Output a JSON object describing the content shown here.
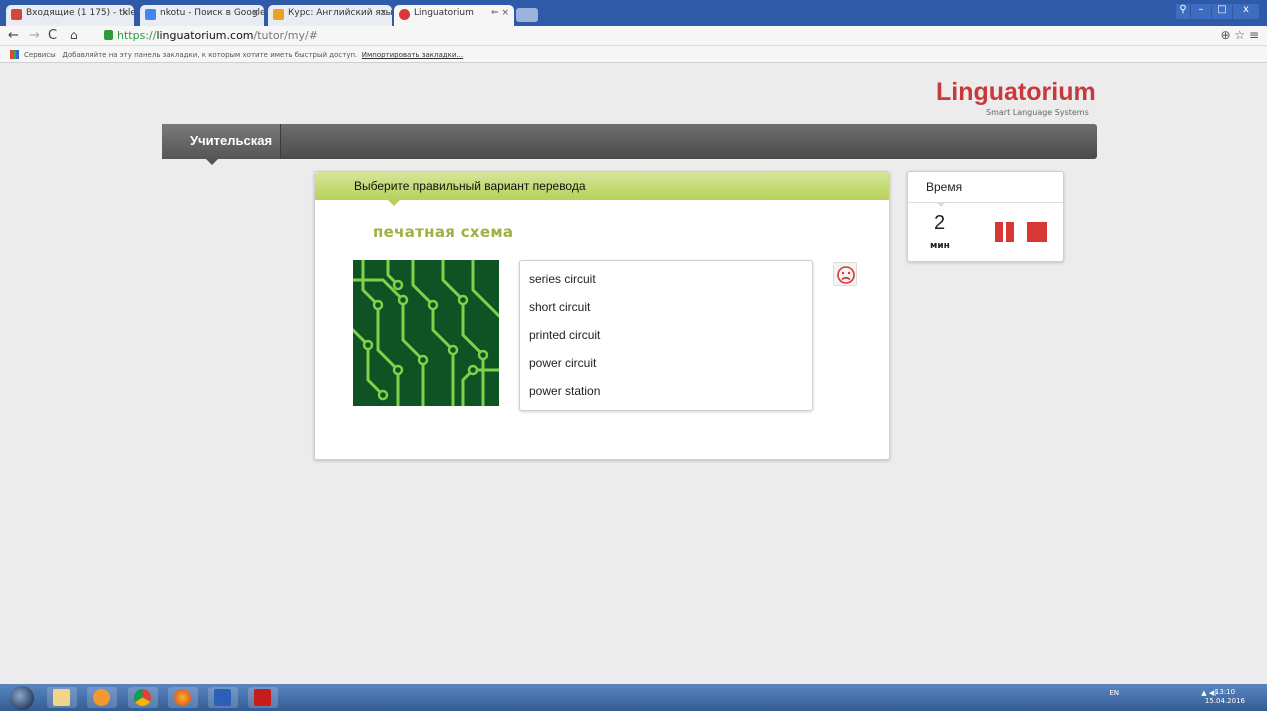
{
  "browser": {
    "tabs": [
      {
        "label": "Входящие (1 175) - tklep",
        "favicon": "gmail-icon",
        "color": "#d44638",
        "active": false
      },
      {
        "label": "nkotu - Поиск в Google",
        "favicon": "google-icon",
        "color": "#4285f4",
        "active": false
      },
      {
        "label": "Курс: Английский язык",
        "favicon": "course-icon",
        "color": "#e6a420",
        "active": false
      },
      {
        "label": "Linguatorium",
        "favicon": "linguatorium-icon",
        "color": "#d93636",
        "active": true
      }
    ],
    "url_scheme": "https://",
    "url_host": "linguatorium.com",
    "url_path": "/tutor/my/#",
    "bookmarks_apps": "Сервисы",
    "bookmarks_prompt": "Добавляйте на эту панель закладки, к которым хотите иметь быстрый доступ.",
    "bookmarks_import": "Импортировать закладки..."
  },
  "logo": {
    "title": "Linguatorium",
    "subtitle": "Smart Language Systems"
  },
  "nav": {
    "tab_label": "Учительская"
  },
  "exercise": {
    "instruction": "Выберите правильный вариант перевода",
    "word": "печатная схема",
    "image": "circuit-board-image",
    "options": [
      "series circuit",
      "short circuit",
      "printed circuit",
      "power circuit",
      "power station"
    ],
    "feedback_icon": "sad-face-icon"
  },
  "timer": {
    "title": "Время",
    "value": "2",
    "unit": "мин"
  },
  "taskbar": {
    "tray_lang": "EN",
    "time": "13:10",
    "date": "15.04.2016"
  },
  "colors": {
    "accent_red": "#c8393b",
    "header_green": "#b6d05a",
    "word_green": "#9cb243"
  }
}
